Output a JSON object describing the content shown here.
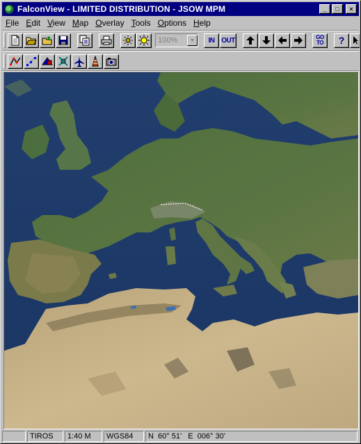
{
  "window": {
    "title": "FalconView - LIMITED DISTRIBUTION - JSOW MPM",
    "minimize_glyph": "_",
    "maximize_glyph": "□",
    "close_glyph": "×"
  },
  "menu": [
    {
      "key": "F",
      "rest": "ile"
    },
    {
      "key": "E",
      "rest": "dit"
    },
    {
      "key": "V",
      "rest": "iew"
    },
    {
      "key": "M",
      "rest": "ap"
    },
    {
      "key": "O",
      "rest": "verlay"
    },
    {
      "key": "T",
      "rest": "ools"
    },
    {
      "key": "O",
      "rest": "ptions"
    },
    {
      "key": "H",
      "rest": "elp"
    }
  ],
  "toolbar": {
    "zoom_value": "100%",
    "zoom_in_label": "IN",
    "zoom_out_label": "OUT",
    "goto_label": "GO TO",
    "help_label": "?"
  },
  "status": {
    "map_source": "TIROS",
    "scale": "1:40 M",
    "datum": "WGS84",
    "coordinates": "N  60° 51'   E  006° 30'"
  },
  "colors": {
    "titlebar": "#000080",
    "chrome": "#c0c0c0",
    "sea": "#1e3d6e",
    "land": "#4a6b3a",
    "desert": "#c8b48a"
  }
}
